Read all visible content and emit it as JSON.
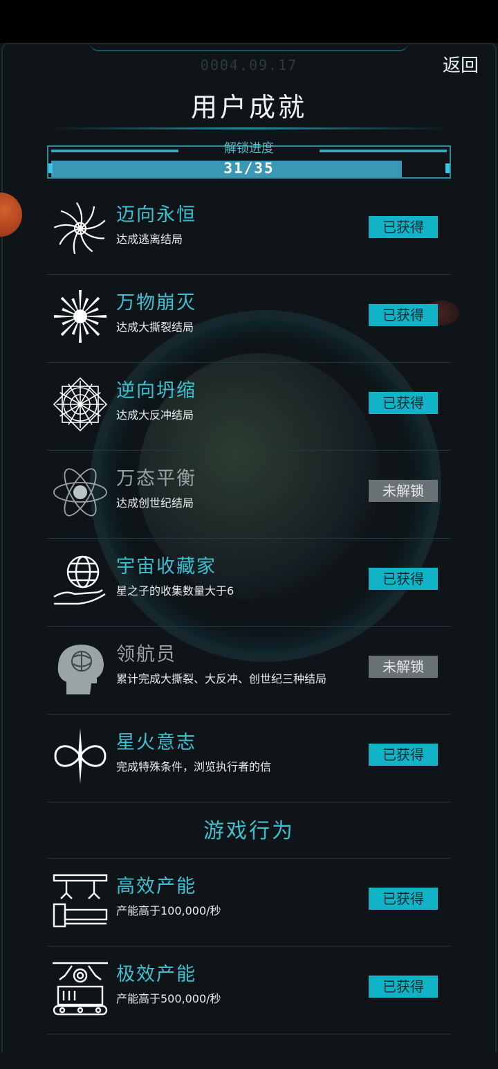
{
  "header": {
    "date": "0004.09.17",
    "back_label": "返回",
    "title": "用户成就"
  },
  "progress": {
    "label": "解锁进度",
    "unlocked": 31,
    "total": 35,
    "count_text": "31/35"
  },
  "achievements": [
    {
      "icon": "vortex-icon",
      "name": "迈向永恒",
      "desc": "达成逃离结局",
      "status": "已获得",
      "unlocked": true
    },
    {
      "icon": "starburst-icon",
      "name": "万物崩灭",
      "desc": "达成大撕裂结局",
      "status": "已获得",
      "unlocked": true
    },
    {
      "icon": "crystal-icon",
      "name": "逆向坍缩",
      "desc": "达成大反冲结局",
      "status": "已获得",
      "unlocked": true
    },
    {
      "icon": "atom-icon",
      "name": "万态平衡",
      "desc": "达成创世纪结局",
      "status": "未解锁",
      "unlocked": false
    },
    {
      "icon": "globe-hand-icon",
      "name": "宇宙收藏家",
      "desc": "星之子的收集数量大于6",
      "status": "已获得",
      "unlocked": true
    },
    {
      "icon": "brain-head-icon",
      "name": "领航员",
      "desc": "累计完成大撕裂、大反冲、创世纪三种结局",
      "status": "未解锁",
      "unlocked": false
    },
    {
      "icon": "infinity-icon",
      "name": "星火意志",
      "desc": "完成特殊条件，浏览执行者的信",
      "status": "已获得",
      "unlocked": true
    }
  ],
  "section_title": "游戏行为",
  "behavior_achievements": [
    {
      "icon": "factory-arm-icon",
      "name": "高效产能",
      "desc": "产能高于100,000/秒",
      "status": "已获得",
      "unlocked": true
    },
    {
      "icon": "gear-robot-icon",
      "name": "极效产能",
      "desc": "产能高于500,000/秒",
      "status": "已获得",
      "unlocked": true
    }
  ],
  "colors": {
    "accent": "#3ec0d0",
    "badge_unlocked": "#11b3c7",
    "badge_locked": "#6b7275",
    "background": "#0e1417",
    "progress_bar": "#3a97b5"
  }
}
